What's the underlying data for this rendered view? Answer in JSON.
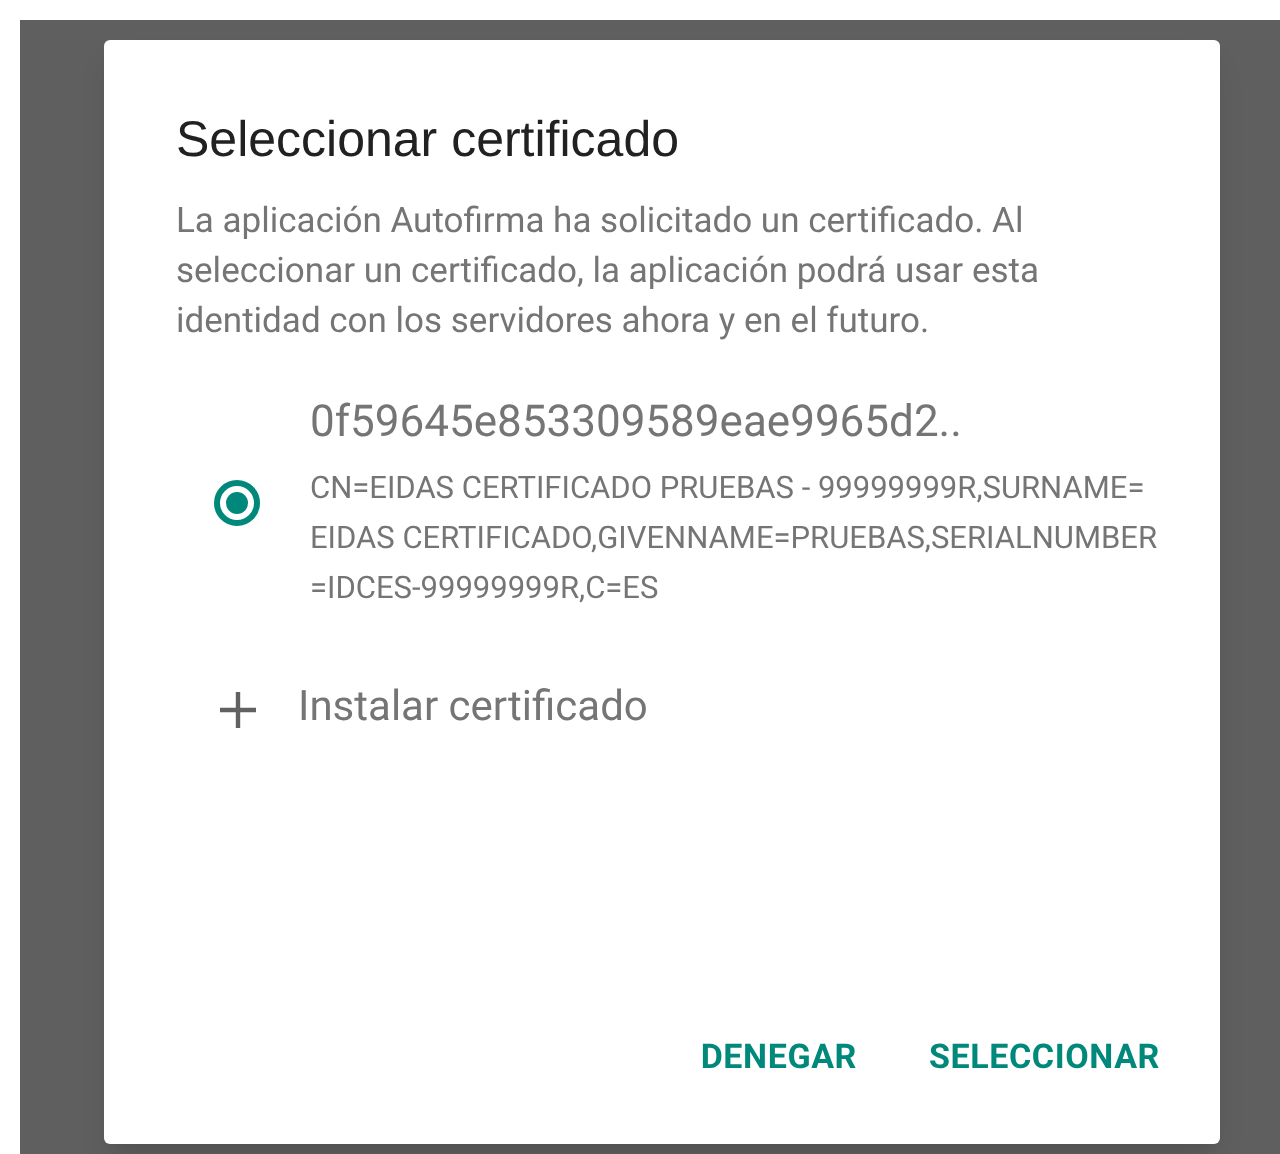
{
  "dialog": {
    "title": "Seleccionar certificado",
    "message": "La aplicación Autofirma ha solicitado un certificado. Al seleccionar un certificado, la aplicación podrá usar esta identidad con los servidores ahora y en el futuro.",
    "certificates": [
      {
        "alias": "0f59645e853309589eae9965d2..",
        "subject": "CN=EIDAS CERTIFICADO PRUEBAS - 99999999R,SURNAME=EIDAS CERTIFICADO,GIVENNAME=PRUEBAS,SERIALNUMBER=IDCES-99999999R,C=ES",
        "selected": true
      }
    ],
    "install_action": {
      "label": "Instalar certificado"
    },
    "buttons": [
      {
        "label": "DENEGAR"
      },
      {
        "label": "SELECCIONAR"
      }
    ]
  }
}
